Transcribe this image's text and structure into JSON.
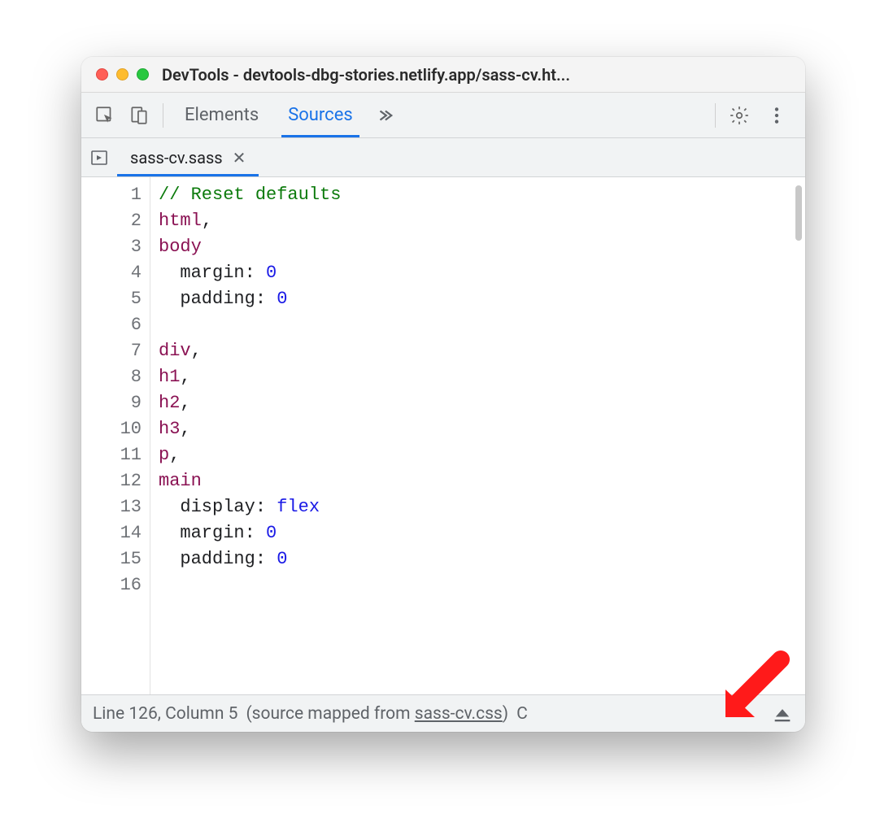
{
  "window": {
    "title": "DevTools - devtools-dbg-stories.netlify.app/sass-cv.ht..."
  },
  "toolbar": {
    "tabs": [
      "Elements",
      "Sources"
    ],
    "activeTabIndex": 1
  },
  "fileTabs": {
    "active": "sass-cv.sass"
  },
  "editor": {
    "lines": [
      {
        "n": 1,
        "tokens": [
          {
            "t": "// Reset defaults",
            "c": "cm"
          }
        ]
      },
      {
        "n": 2,
        "tokens": [
          {
            "t": "html",
            "c": "sel"
          },
          {
            "t": ",",
            "c": ""
          }
        ]
      },
      {
        "n": 3,
        "tokens": [
          {
            "t": "body",
            "c": "sel"
          }
        ]
      },
      {
        "n": 4,
        "tokens": [
          {
            "t": "  margin",
            "c": "prop"
          },
          {
            "t": ": ",
            "c": ""
          },
          {
            "t": "0",
            "c": "val-num"
          }
        ]
      },
      {
        "n": 5,
        "tokens": [
          {
            "t": "  padding",
            "c": "prop"
          },
          {
            "t": ": ",
            "c": ""
          },
          {
            "t": "0",
            "c": "val-num"
          }
        ]
      },
      {
        "n": 6,
        "tokens": []
      },
      {
        "n": 7,
        "tokens": [
          {
            "t": "div",
            "c": "sel"
          },
          {
            "t": ",",
            "c": ""
          }
        ]
      },
      {
        "n": 8,
        "tokens": [
          {
            "t": "h1",
            "c": "sel"
          },
          {
            "t": ",",
            "c": ""
          }
        ]
      },
      {
        "n": 9,
        "tokens": [
          {
            "t": "h2",
            "c": "sel"
          },
          {
            "t": ",",
            "c": ""
          }
        ]
      },
      {
        "n": 10,
        "tokens": [
          {
            "t": "h3",
            "c": "sel"
          },
          {
            "t": ",",
            "c": ""
          }
        ]
      },
      {
        "n": 11,
        "tokens": [
          {
            "t": "p",
            "c": "sel"
          },
          {
            "t": ",",
            "c": ""
          }
        ]
      },
      {
        "n": 12,
        "tokens": [
          {
            "t": "main",
            "c": "sel"
          }
        ]
      },
      {
        "n": 13,
        "tokens": [
          {
            "t": "  display",
            "c": "prop"
          },
          {
            "t": ": ",
            "c": ""
          },
          {
            "t": "flex",
            "c": "val-kw"
          }
        ]
      },
      {
        "n": 14,
        "tokens": [
          {
            "t": "  margin",
            "c": "prop"
          },
          {
            "t": ": ",
            "c": ""
          },
          {
            "t": "0",
            "c": "val-num"
          }
        ]
      },
      {
        "n": 15,
        "tokens": [
          {
            "t": "  padding",
            "c": "prop"
          },
          {
            "t": ": ",
            "c": ""
          },
          {
            "t": "0",
            "c": "val-num"
          }
        ]
      },
      {
        "n": 16,
        "tokens": []
      }
    ]
  },
  "status": {
    "lineColText": "Line 126, Column 5",
    "mappedPrefix": "(source mapped from ",
    "mappedLink": "sass-cv.css",
    "mappedSuffix": ")",
    "trailing": "C"
  }
}
